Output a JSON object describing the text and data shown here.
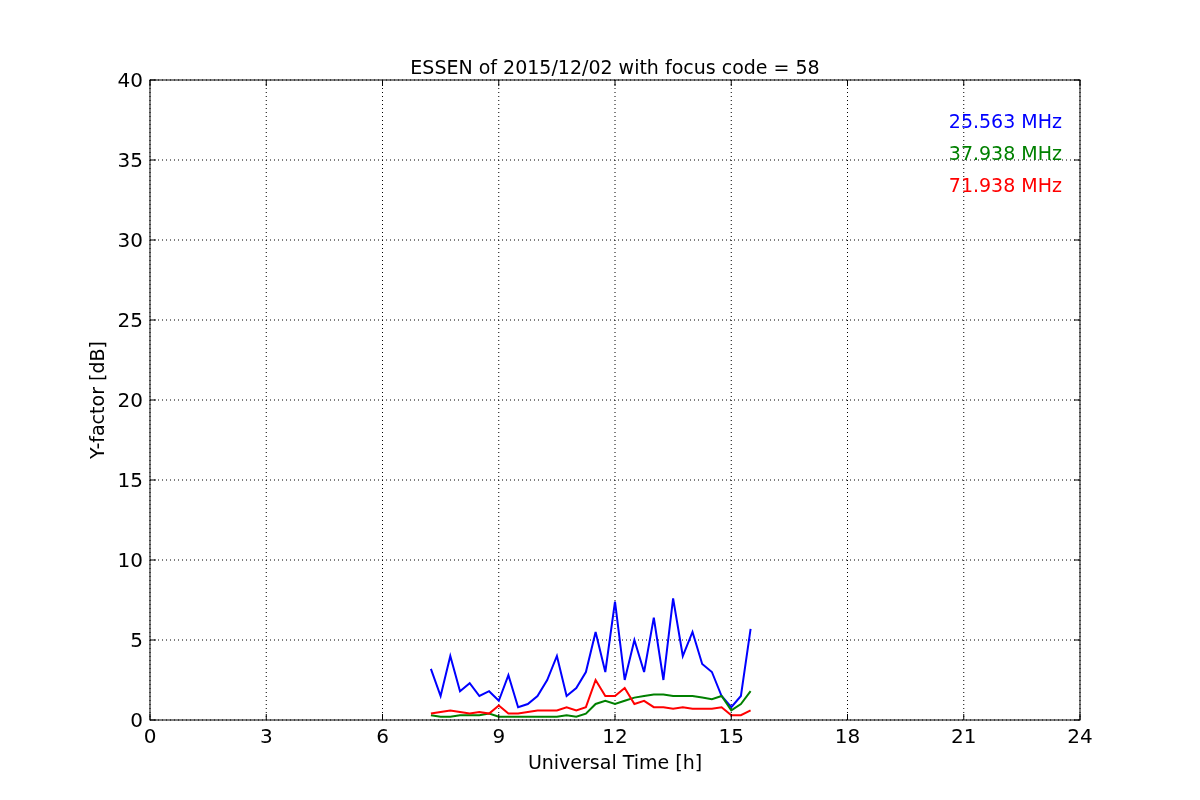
{
  "chart_data": {
    "type": "line",
    "title": "ESSEN of 2015/12/02 with focus code = 58",
    "xlabel": "Universal Time [h]",
    "ylabel": "Y-factor [dB]",
    "x": [
      7.25,
      7.5,
      7.75,
      8,
      8.25,
      8.5,
      8.75,
      9,
      9.25,
      9.5,
      9.75,
      10,
      10.25,
      10.5,
      10.75,
      11,
      11.25,
      11.5,
      11.75,
      12,
      12.25,
      12.5,
      12.75,
      13,
      13.25,
      13.5,
      13.75,
      14,
      14.25,
      14.5,
      14.75,
      15,
      15.25,
      15.5
    ],
    "series": [
      {
        "name": "25.563 MHz",
        "color": "#0000ff",
        "values": [
          3.2,
          1.5,
          4.0,
          1.8,
          2.3,
          1.5,
          1.8,
          1.2,
          2.8,
          0.8,
          1.0,
          1.5,
          2.5,
          4.0,
          1.5,
          2.0,
          3.0,
          5.5,
          3.0,
          7.4,
          2.5,
          5.0,
          3.0,
          6.4,
          2.5,
          7.6,
          4.0,
          5.5,
          3.5,
          3.0,
          1.5,
          0.8,
          1.5,
          5.7
        ]
      },
      {
        "name": "37.938 MHz",
        "color": "#008000",
        "values": [
          0.3,
          0.2,
          0.2,
          0.3,
          0.3,
          0.3,
          0.4,
          0.2,
          0.2,
          0.2,
          0.2,
          0.2,
          0.2,
          0.2,
          0.3,
          0.2,
          0.4,
          1.0,
          1.2,
          1.0,
          1.2,
          1.4,
          1.5,
          1.6,
          1.6,
          1.5,
          1.5,
          1.5,
          1.4,
          1.3,
          1.5,
          0.6,
          1.0,
          1.8
        ]
      },
      {
        "name": "71.938 MHz",
        "color": "#ff0000",
        "values": [
          0.4,
          0.5,
          0.6,
          0.5,
          0.4,
          0.5,
          0.4,
          0.9,
          0.4,
          0.4,
          0.5,
          0.6,
          0.6,
          0.6,
          0.8,
          0.6,
          0.8,
          2.5,
          1.5,
          1.5,
          2.0,
          1.0,
          1.2,
          0.8,
          0.8,
          0.7,
          0.8,
          0.7,
          0.7,
          0.7,
          0.8,
          0.3,
          0.3,
          0.6
        ]
      }
    ],
    "grid": true,
    "xlim": [
      0,
      24
    ],
    "ylim": [
      0,
      40
    ],
    "xticks": [
      0,
      3,
      6,
      9,
      12,
      15,
      18,
      21,
      24
    ],
    "yticks": [
      0,
      5,
      10,
      15,
      20,
      25,
      30,
      35,
      40
    ]
  }
}
